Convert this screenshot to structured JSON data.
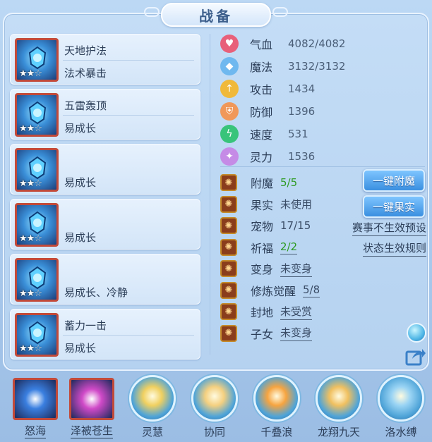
{
  "title": "战备",
  "gear": [
    {
      "name": "天地护法",
      "effect": "法术暴击",
      "stars_on": 2,
      "stars_total": 3,
      "icon": "spear-blue-icon"
    },
    {
      "name": "五雷轰顶",
      "effect": "易成长",
      "stars_on": 2,
      "stars_total": 3,
      "icon": "helmet-blue-icon"
    },
    {
      "name": "",
      "effect": "易成长",
      "stars_on": 2,
      "stars_total": 3,
      "icon": "crown-blue-icon"
    },
    {
      "name": "",
      "effect": "易成长",
      "stars_on": 2,
      "stars_total": 3,
      "icon": "armor-blue-icon"
    },
    {
      "name": "",
      "effect": "易成长、冷静",
      "stars_on": 2,
      "stars_total": 3,
      "icon": "belt-blue-icon"
    },
    {
      "name": "蓄力一击",
      "effect": "易成长",
      "stars_on": 2,
      "stars_total": 3,
      "icon": "boots-blue-icon"
    }
  ],
  "stats": [
    {
      "label": "气血",
      "value": "4082/4082",
      "icon": "heart-icon",
      "color": "#e8607a"
    },
    {
      "label": "魔法",
      "value": "3132/3132",
      "icon": "mana-gem-icon",
      "color": "#6fb8ef"
    },
    {
      "label": "攻击",
      "value": "1434",
      "icon": "sword-icon",
      "color": "#f0b93a"
    },
    {
      "label": "防御",
      "value": "1396",
      "icon": "shield-icon",
      "color": "#f0985a"
    },
    {
      "label": "速度",
      "value": "531",
      "icon": "lightning-icon",
      "color": "#38c47a"
    },
    {
      "label": "灵力",
      "value": "1536",
      "icon": "spirit-icon",
      "color": "#c58be6"
    }
  ],
  "extras": [
    {
      "label": "附魔",
      "value": "5/5",
      "green": true,
      "underline": false,
      "icon": "enchant-icon"
    },
    {
      "label": "果实",
      "value": "未使用",
      "green": false,
      "underline": false,
      "icon": "fruit-icon"
    },
    {
      "label": "宠物",
      "value": "17/15",
      "green": false,
      "underline": false,
      "icon": "pet-icon"
    },
    {
      "label": "祈福",
      "value": "2/2",
      "green": true,
      "underline": true,
      "icon": "blessing-icon"
    },
    {
      "label": "变身",
      "value": "未变身",
      "green": false,
      "underline": true,
      "icon": "transform-icon"
    },
    {
      "label": "修炼觉醒",
      "value": "5/8",
      "green": false,
      "underline": true,
      "icon": "cultivation-icon"
    },
    {
      "label": "封地",
      "value": "未受赏",
      "green": false,
      "underline": true,
      "icon": "fief-icon"
    },
    {
      "label": "子女",
      "value": "未变身",
      "green": false,
      "underline": true,
      "icon": "child-icon"
    }
  ],
  "buttons": {
    "enchant_all": "一键附魔",
    "fruit_all": "一键果实"
  },
  "links": {
    "preset": "赛事不生效预设",
    "rules": "状态生效规则"
  },
  "skills": [
    {
      "name": "怒海",
      "style": "square",
      "underline": true,
      "color": "#3a7fe0"
    },
    {
      "name": "泽被苍生",
      "style": "square",
      "underline": true,
      "color": "#d04ac8"
    },
    {
      "name": "灵慧",
      "style": "round",
      "underline": false,
      "color": "#f0d060"
    },
    {
      "name": "协同",
      "style": "round",
      "underline": false,
      "color": "#f4d080"
    },
    {
      "name": "千叠浪",
      "style": "round",
      "underline": false,
      "color": "#f6a440"
    },
    {
      "name": "龙翔九天",
      "style": "round",
      "underline": false,
      "color": "#f0c060"
    },
    {
      "name": "洛水缚",
      "style": "round",
      "underline": false,
      "color": "#9ad4f4"
    }
  ]
}
